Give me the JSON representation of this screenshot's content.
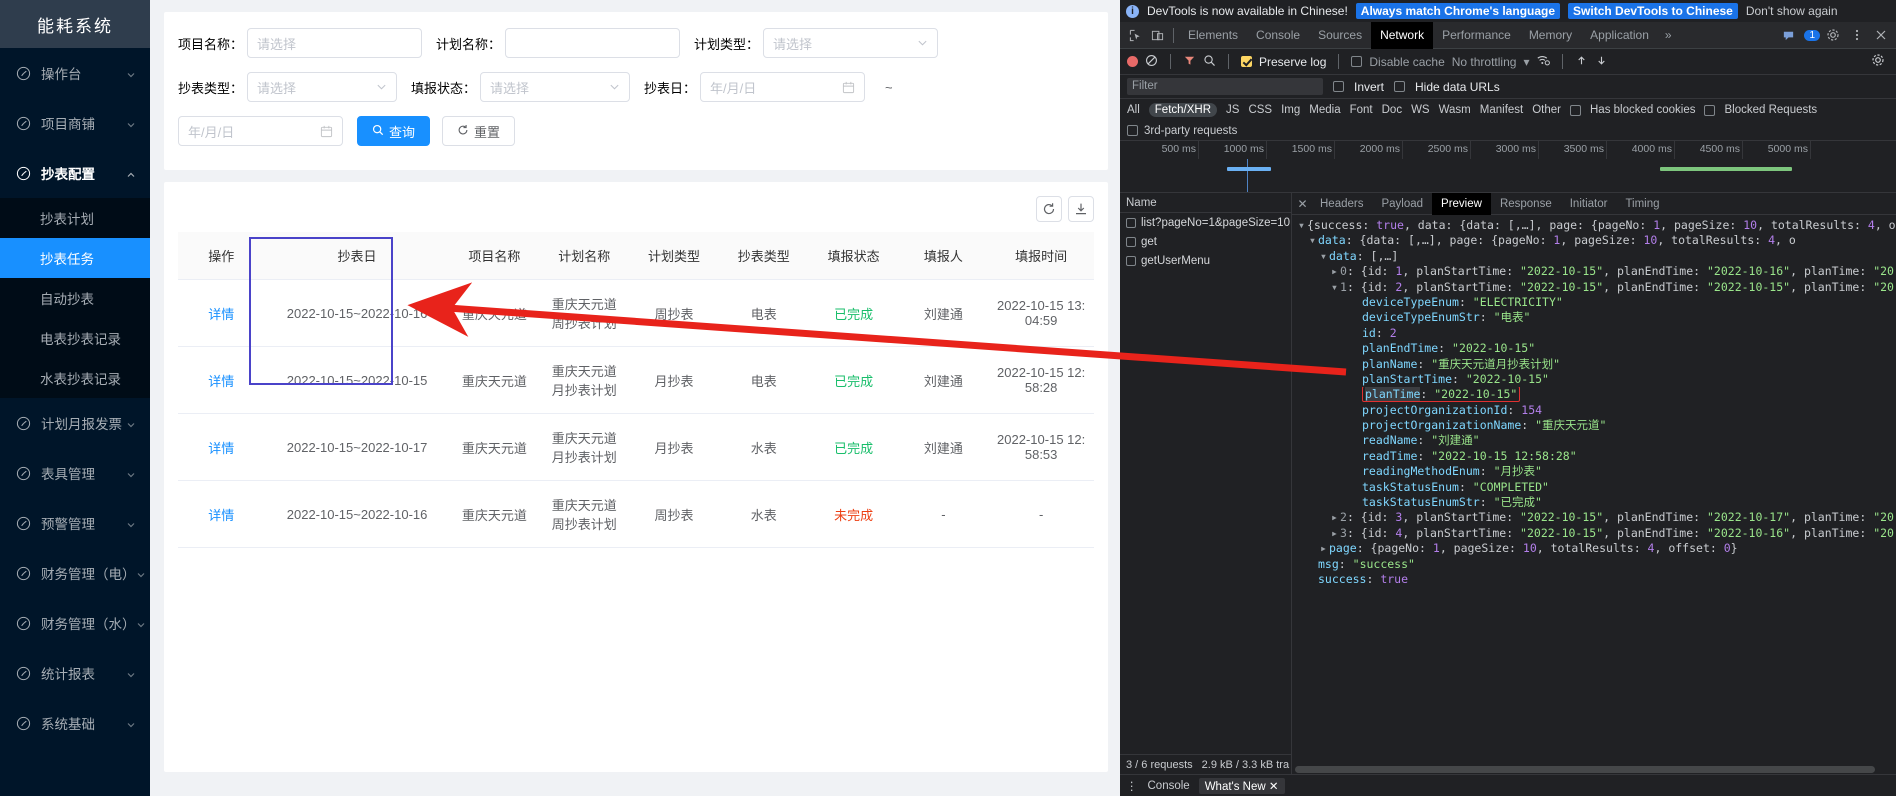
{
  "app": {
    "logo_title": "能耗系统",
    "menu": [
      {
        "label": "操作台",
        "icon": "dashboard-icon",
        "expandable": true,
        "open": false
      },
      {
        "label": "项目商铺",
        "icon": "dashboard-icon",
        "expandable": true,
        "open": false
      },
      {
        "label": "抄表配置",
        "icon": "dashboard-icon",
        "expandable": true,
        "open": true
      }
    ],
    "submenu": [
      {
        "label": "抄表计划",
        "active": false
      },
      {
        "label": "抄表任务",
        "active": true
      },
      {
        "label": "自动抄表",
        "active": false
      },
      {
        "label": "电表抄表记录",
        "active": false
      },
      {
        "label": "水表抄表记录",
        "active": false
      }
    ],
    "menu_after": [
      {
        "label": "计划月报发票",
        "icon": "dashboard-icon",
        "expandable": true
      },
      {
        "label": "表具管理",
        "icon": "dashboard-icon",
        "expandable": true
      },
      {
        "label": "预警管理",
        "icon": "dashboard-icon",
        "expandable": true
      },
      {
        "label": "财务管理（电）",
        "icon": "dashboard-icon",
        "expandable": true
      },
      {
        "label": "财务管理（水）",
        "icon": "dashboard-icon",
        "expandable": true
      },
      {
        "label": "统计报表",
        "icon": "dashboard-icon",
        "expandable": true
      },
      {
        "label": "系统基础",
        "icon": "dashboard-icon",
        "expandable": true
      }
    ],
    "search": {
      "project_name_label": "项目名称：",
      "project_name_placeholder": "请选择",
      "plan_name_label": "计划名称：",
      "plan_name_placeholder": "",
      "plan_type_label": "计划类型：",
      "plan_type_placeholder": "请选择",
      "meter_type_label": "抄表类型：",
      "meter_type_placeholder": "请选择",
      "fill_status_label": "填报状态：",
      "fill_status_placeholder": "请选择",
      "read_date_label": "抄表日：",
      "read_date_start_placeholder": "年/月/日",
      "range_separator": "~",
      "read_date_end_placeholder": "年/月/日",
      "query_button": "查询",
      "reset_button": "重置"
    },
    "table": {
      "refresh_icon": "refresh-icon",
      "download_icon": "download-icon",
      "columns": [
        "操作",
        "抄表日",
        "项目名称",
        "计划名称",
        "计划类型",
        "抄表类型",
        "填报状态",
        "填报人",
        "填报时间"
      ],
      "rows": [
        {
          "action": "详情",
          "read_date": "2022-10-15~2022-10-16",
          "project_name": "重庆天元道",
          "plan_name": "重庆天元道周抄表计划",
          "plan_type": "周抄表",
          "meter_type": "电表",
          "status": "已完成",
          "status_kind": "done",
          "reporter": "刘建通",
          "report_time": "2022-10-15 13:04:59"
        },
        {
          "action": "详情",
          "read_date": "2022-10-15~2022-10-15",
          "project_name": "重庆天元道",
          "plan_name": "重庆天元道月抄表计划",
          "plan_type": "月抄表",
          "meter_type": "电表",
          "status": "已完成",
          "status_kind": "done",
          "reporter": "刘建通",
          "report_time": "2022-10-15 12:58:28"
        },
        {
          "action": "详情",
          "read_date": "2022-10-15~2022-10-17",
          "project_name": "重庆天元道",
          "plan_name": "重庆天元道月抄表计划",
          "plan_type": "月抄表",
          "meter_type": "水表",
          "status": "已完成",
          "status_kind": "done",
          "reporter": "刘建通",
          "report_time": "2022-10-15 12:58:53"
        },
        {
          "action": "详情",
          "read_date": "2022-10-15~2022-10-16",
          "project_name": "重庆天元道",
          "plan_name": "重庆天元道周抄表计划",
          "plan_type": "周抄表",
          "meter_type": "水表",
          "status": "未完成",
          "status_kind": "undone",
          "reporter": "-",
          "report_time": "-"
        }
      ]
    }
  },
  "devtools": {
    "banner": {
      "info_icon": "info-icon",
      "message": "DevTools is now available in Chinese!",
      "primary_button": "Always match Chrome's language",
      "secondary_button": "Switch DevTools to Chinese",
      "dismiss_button": "Don't show again"
    },
    "tabs": [
      {
        "label": "Elements",
        "active": false
      },
      {
        "label": "Console",
        "active": false
      },
      {
        "label": "Sources",
        "active": false
      },
      {
        "label": "Network",
        "active": true
      },
      {
        "label": "Performance",
        "active": false
      },
      {
        "label": "Memory",
        "active": false
      },
      {
        "label": "Application",
        "active": false
      }
    ],
    "more_tabs_icon": "chevron-double-right-icon",
    "issue_count": "1",
    "settings_icon": "gear-icon",
    "kebab_icon": "more-vertical-icon",
    "close_icon": "close-icon",
    "network_toolbar": {
      "record_icon": "record-icon",
      "clear_icon": "clear-icon",
      "filter_icon": "funnel-icon",
      "search_icon": "search-icon",
      "preserve_log": "Preserve log",
      "preserve_log_checked": true,
      "disable_cache": "Disable cache",
      "disable_cache_checked": false,
      "throttling": "No throttling",
      "wifi_icon": "wifi-settings-icon",
      "import_icon": "upload-icon",
      "export_icon": "download-icon"
    },
    "filter_row": {
      "filter_placeholder": "Filter",
      "invert": "Invert",
      "hide_data_urls": "Hide data URLs"
    },
    "type_filters": [
      "All",
      "Fetch/XHR",
      "JS",
      "CSS",
      "Img",
      "Media",
      "Font",
      "Doc",
      "WS",
      "Wasm",
      "Manifest",
      "Other"
    ],
    "type_filter_selected": "Fetch/XHR",
    "blocked_cookies": "Has blocked cookies",
    "blocked_requests": "Blocked Requests",
    "third_party": "3rd-party requests",
    "timeline_ticks": [
      "500 ms",
      "1000 ms",
      "1500 ms",
      "2000 ms",
      "2500 ms",
      "3000 ms",
      "3500 ms",
      "4000 ms",
      "4500 ms",
      "5000 ms"
    ],
    "request_list": {
      "header": "Name",
      "items": [
        "list?pageNo=1&pageSize=10",
        "get",
        "getUserMenu"
      ]
    },
    "request_footer": {
      "requests": "3 / 6 requests",
      "transferred": "2.9 kB / 3.3 kB tra"
    },
    "detail_tabs": [
      {
        "label": "Headers",
        "active": false
      },
      {
        "label": "Payload",
        "active": false
      },
      {
        "label": "Preview",
        "active": true
      },
      {
        "label": "Response",
        "active": false
      },
      {
        "label": "Initiator",
        "active": false
      },
      {
        "label": "Timing",
        "active": false
      }
    ],
    "preview_lines": [
      {
        "indent": 0,
        "tri": "d",
        "parts": [
          {
            "t": "{success: ",
            "c": "pl"
          },
          {
            "t": "true",
            "c": "bo"
          },
          {
            "t": ", data: {data: [,…], page: {pageNo: ",
            "c": "pl"
          },
          {
            "t": "1",
            "c": "n"
          },
          {
            "t": ", pageSize: ",
            "c": "pl"
          },
          {
            "t": "10",
            "c": "n"
          },
          {
            "t": ", totalResults: ",
            "c": "pl"
          },
          {
            "t": "4",
            "c": "n"
          },
          {
            "t": ", of",
            "c": "pl"
          }
        ]
      },
      {
        "indent": 1,
        "tri": "d",
        "parts": [
          {
            "t": "data",
            "c": "kb"
          },
          {
            "t": ": {data: [,…], page: {pageNo: ",
            "c": "pl"
          },
          {
            "t": "1",
            "c": "n"
          },
          {
            "t": ", pageSize: ",
            "c": "pl"
          },
          {
            "t": "10",
            "c": "n"
          },
          {
            "t": ", totalResults: ",
            "c": "pl"
          },
          {
            "t": "4",
            "c": "n"
          },
          {
            "t": ", o",
            "c": "pl"
          }
        ]
      },
      {
        "indent": 2,
        "tri": "d",
        "parts": [
          {
            "t": "data",
            "c": "kb"
          },
          {
            "t": ": [,…]",
            "c": "pl"
          }
        ]
      },
      {
        "indent": 3,
        "tri": "r",
        "parts": [
          {
            "t": "0",
            "c": "k"
          },
          {
            "t": ": {id: ",
            "c": "pl"
          },
          {
            "t": "1",
            "c": "n"
          },
          {
            "t": ", planStartTime: ",
            "c": "pl"
          },
          {
            "t": "\"2022-10-15\"",
            "c": "s"
          },
          {
            "t": ", planEndTime: ",
            "c": "pl"
          },
          {
            "t": "\"2022-10-16\"",
            "c": "s"
          },
          {
            "t": ", planTime: ",
            "c": "pl"
          },
          {
            "t": "\"20",
            "c": "s"
          }
        ]
      },
      {
        "indent": 3,
        "tri": "d",
        "parts": [
          {
            "t": "1",
            "c": "k"
          },
          {
            "t": ": {id: ",
            "c": "pl"
          },
          {
            "t": "2",
            "c": "n"
          },
          {
            "t": ", planStartTime: ",
            "c": "pl"
          },
          {
            "t": "\"2022-10-15\"",
            "c": "s"
          },
          {
            "t": ", planEndTime: ",
            "c": "pl"
          },
          {
            "t": "\"2022-10-15\"",
            "c": "s"
          },
          {
            "t": ", planTime: ",
            "c": "pl"
          },
          {
            "t": "\"20",
            "c": "s"
          }
        ]
      },
      {
        "indent": 5,
        "tri": "",
        "parts": [
          {
            "t": "deviceTypeEnum",
            "c": "kb"
          },
          {
            "t": ": ",
            "c": "pl"
          },
          {
            "t": "\"ELECTRICITY\"",
            "c": "s"
          }
        ]
      },
      {
        "indent": 5,
        "tri": "",
        "parts": [
          {
            "t": "deviceTypeEnumStr",
            "c": "kb"
          },
          {
            "t": ": ",
            "c": "pl"
          },
          {
            "t": "\"电表\"",
            "c": "s"
          }
        ]
      },
      {
        "indent": 5,
        "tri": "",
        "parts": [
          {
            "t": "id",
            "c": "kb"
          },
          {
            "t": ": ",
            "c": "pl"
          },
          {
            "t": "2",
            "c": "n"
          }
        ]
      },
      {
        "indent": 5,
        "tri": "",
        "parts": [
          {
            "t": "planEndTime",
            "c": "kb"
          },
          {
            "t": ": ",
            "c": "pl"
          },
          {
            "t": "\"2022-10-15\"",
            "c": "s"
          }
        ]
      },
      {
        "indent": 5,
        "tri": "",
        "parts": [
          {
            "t": "planName",
            "c": "kb"
          },
          {
            "t": ": ",
            "c": "pl"
          },
          {
            "t": "\"重庆天元道月抄表计划\"",
            "c": "s"
          }
        ]
      },
      {
        "indent": 5,
        "tri": "",
        "parts": [
          {
            "t": "planStartTime",
            "c": "kb"
          },
          {
            "t": ": ",
            "c": "pl"
          },
          {
            "t": "\"2022-10-15\"",
            "c": "s"
          }
        ]
      },
      {
        "indent": 5,
        "tri": "",
        "highlight": true,
        "parts": [
          {
            "t": "planTime",
            "c": "kb sel-bg"
          },
          {
            "t": ": ",
            "c": "pl"
          },
          {
            "t": "\"2022-10-15\"",
            "c": "s"
          }
        ]
      },
      {
        "indent": 5,
        "tri": "",
        "parts": [
          {
            "t": "projectOrganizationId",
            "c": "kb"
          },
          {
            "t": ": ",
            "c": "pl"
          },
          {
            "t": "154",
            "c": "n"
          }
        ]
      },
      {
        "indent": 5,
        "tri": "",
        "parts": [
          {
            "t": "projectOrganizationName",
            "c": "kb"
          },
          {
            "t": ": ",
            "c": "pl"
          },
          {
            "t": "\"重庆天元道\"",
            "c": "s"
          }
        ]
      },
      {
        "indent": 5,
        "tri": "",
        "parts": [
          {
            "t": "readName",
            "c": "kb"
          },
          {
            "t": ": ",
            "c": "pl"
          },
          {
            "t": "\"刘建通\"",
            "c": "s"
          }
        ]
      },
      {
        "indent": 5,
        "tri": "",
        "parts": [
          {
            "t": "readTime",
            "c": "kb"
          },
          {
            "t": ": ",
            "c": "pl"
          },
          {
            "t": "\"2022-10-15 12:58:28\"",
            "c": "s"
          }
        ]
      },
      {
        "indent": 5,
        "tri": "",
        "parts": [
          {
            "t": "readingMethodEnum",
            "c": "kb"
          },
          {
            "t": ": ",
            "c": "pl"
          },
          {
            "t": "\"月抄表\"",
            "c": "s"
          }
        ]
      },
      {
        "indent": 5,
        "tri": "",
        "parts": [
          {
            "t": "taskStatusEnum",
            "c": "kb"
          },
          {
            "t": ": ",
            "c": "pl"
          },
          {
            "t": "\"COMPLETED\"",
            "c": "s"
          }
        ]
      },
      {
        "indent": 5,
        "tri": "",
        "parts": [
          {
            "t": "taskStatusEnumStr",
            "c": "kb"
          },
          {
            "t": ": ",
            "c": "pl"
          },
          {
            "t": "\"已完成\"",
            "c": "s"
          }
        ]
      },
      {
        "indent": 3,
        "tri": "r",
        "parts": [
          {
            "t": "2",
            "c": "k"
          },
          {
            "t": ": {id: ",
            "c": "pl"
          },
          {
            "t": "3",
            "c": "n"
          },
          {
            "t": ", planStartTime: ",
            "c": "pl"
          },
          {
            "t": "\"2022-10-15\"",
            "c": "s"
          },
          {
            "t": ", planEndTime: ",
            "c": "pl"
          },
          {
            "t": "\"2022-10-17\"",
            "c": "s"
          },
          {
            "t": ", planTime: ",
            "c": "pl"
          },
          {
            "t": "\"20",
            "c": "s"
          }
        ]
      },
      {
        "indent": 3,
        "tri": "r",
        "parts": [
          {
            "t": "3",
            "c": "k"
          },
          {
            "t": ": {id: ",
            "c": "pl"
          },
          {
            "t": "4",
            "c": "n"
          },
          {
            "t": ", planStartTime: ",
            "c": "pl"
          },
          {
            "t": "\"2022-10-15\"",
            "c": "s"
          },
          {
            "t": ", planEndTime: ",
            "c": "pl"
          },
          {
            "t": "\"2022-10-16\"",
            "c": "s"
          },
          {
            "t": ", planTime: ",
            "c": "pl"
          },
          {
            "t": "\"20",
            "c": "s"
          }
        ]
      },
      {
        "indent": 2,
        "tri": "r",
        "parts": [
          {
            "t": "page",
            "c": "kb"
          },
          {
            "t": ": {pageNo: ",
            "c": "pl"
          },
          {
            "t": "1",
            "c": "n"
          },
          {
            "t": ", pageSize: ",
            "c": "pl"
          },
          {
            "t": "10",
            "c": "n"
          },
          {
            "t": ", totalResults: ",
            "c": "pl"
          },
          {
            "t": "4",
            "c": "n"
          },
          {
            "t": ", offset: ",
            "c": "pl"
          },
          {
            "t": "0",
            "c": "n"
          },
          {
            "t": "}",
            "c": "pl"
          }
        ]
      },
      {
        "indent": 1,
        "tri": "",
        "parts": [
          {
            "t": "msg",
            "c": "kb"
          },
          {
            "t": ": ",
            "c": "pl"
          },
          {
            "t": "\"success\"",
            "c": "s"
          }
        ]
      },
      {
        "indent": 1,
        "tri": "",
        "parts": [
          {
            "t": "success",
            "c": "kb"
          },
          {
            "t": ": ",
            "c": "pl"
          },
          {
            "t": "true",
            "c": "bo"
          }
        ]
      }
    ],
    "bottom_bar": {
      "kebab_icon": "more-vertical-icon",
      "console_label": "Console",
      "whats_new_label": "What's New",
      "whats_new_close_icon": "close-icon"
    }
  },
  "annotations": {
    "arrow_color": "#e8231b",
    "column_highlight_color": "#4a43c9",
    "json_highlight_color": "#e03131"
  }
}
